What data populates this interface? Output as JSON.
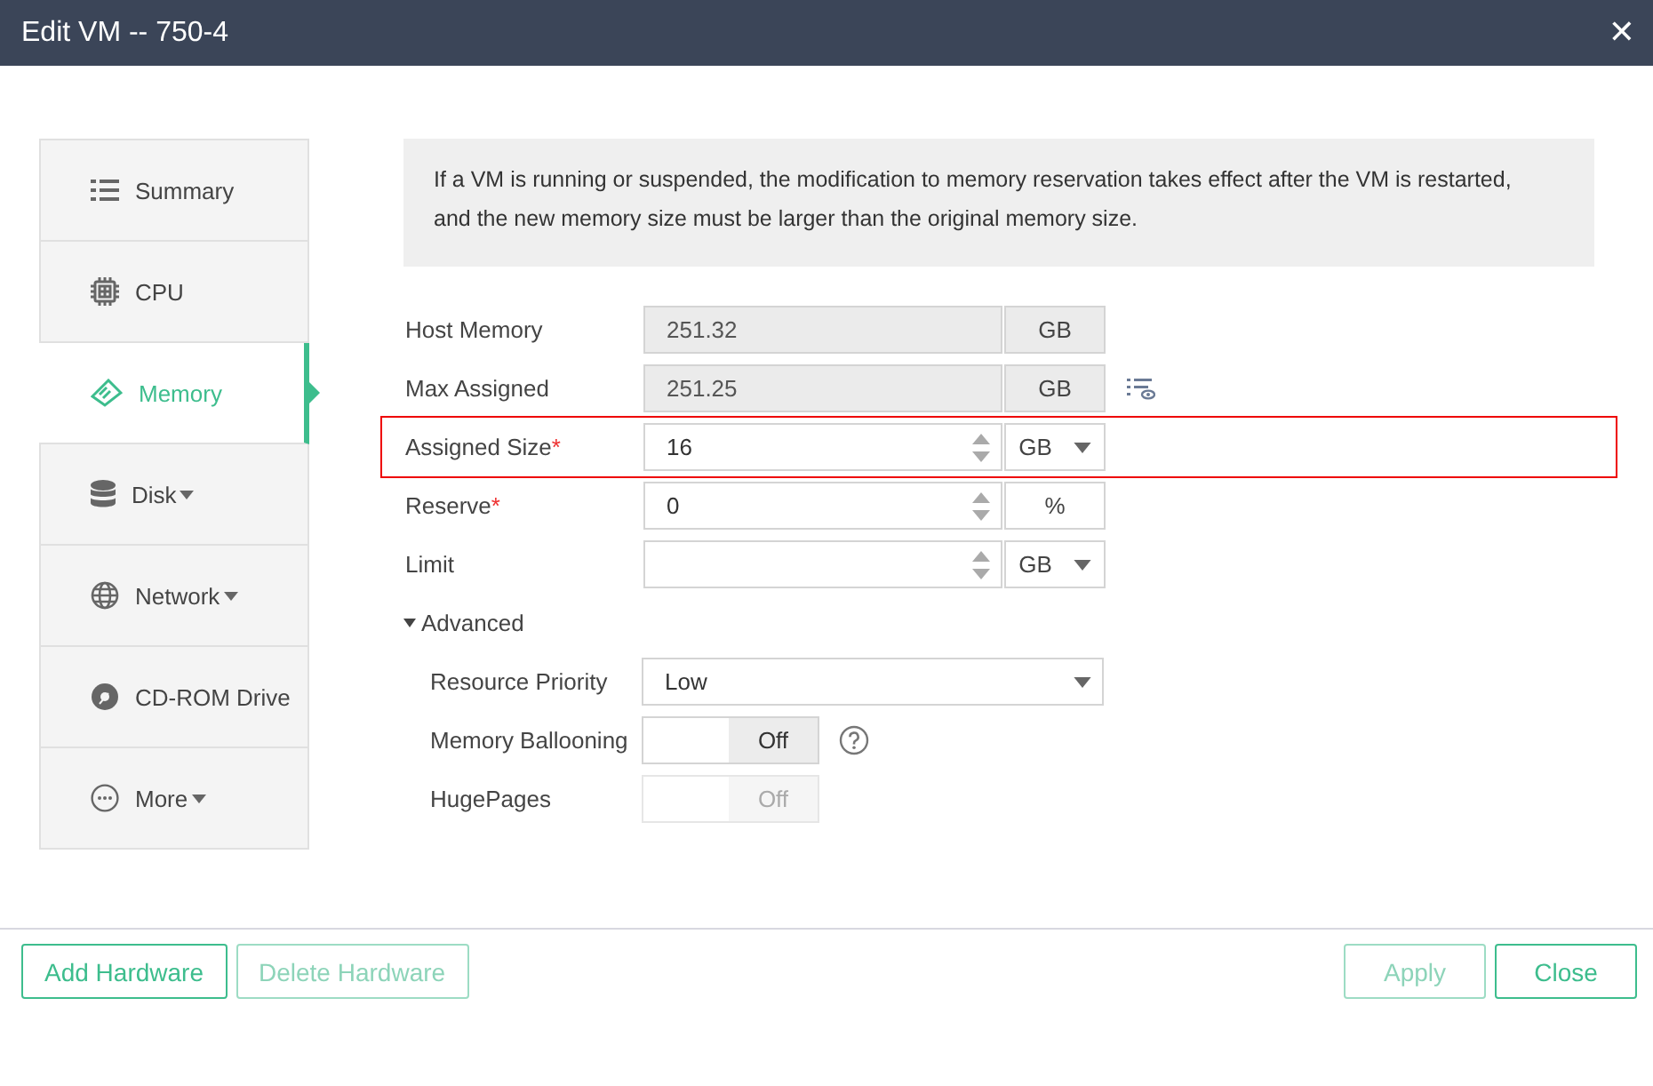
{
  "window": {
    "title": "Edit VM -- 750-4",
    "close": "✕"
  },
  "sidebar": {
    "items": [
      {
        "label": "Summary",
        "selected": false,
        "has_menu": false
      },
      {
        "label": "CPU",
        "selected": false,
        "has_menu": false
      },
      {
        "label": "Memory",
        "selected": true,
        "has_menu": false
      },
      {
        "label": "Disk",
        "selected": false,
        "has_menu": true
      },
      {
        "label": "Network",
        "selected": false,
        "has_menu": true
      },
      {
        "label": "CD-ROM Drive",
        "selected": false,
        "has_menu": false
      },
      {
        "label": "More",
        "selected": false,
        "has_menu": true
      }
    ]
  },
  "notice": "If a VM is running or suspended, the modification to memory reservation takes effect after the VM is restarted, and the new memory size must be larger than the original memory size.",
  "fields": [
    {
      "label": "Host Memory",
      "kind": "readonly",
      "value": "251.32",
      "unit": "GB",
      "unit_dropdown": false,
      "highlighted": false,
      "detail_icon": false
    },
    {
      "label": "Max Assigned",
      "kind": "readonly",
      "value": "251.25",
      "unit": "GB",
      "unit_dropdown": false,
      "highlighted": false,
      "detail_icon": true
    },
    {
      "label": "Assigned Size",
      "kind": "spinner",
      "required_mark": "*",
      "value": "16",
      "unit": "GB",
      "unit_dropdown": true,
      "highlighted": true,
      "detail_icon": false
    },
    {
      "label": "Reserve",
      "kind": "spinner",
      "required_mark": "*",
      "value": "0",
      "unit": "%",
      "unit_dropdown": false,
      "highlighted": false,
      "detail_icon": false
    },
    {
      "label": "Limit",
      "kind": "spinner",
      "unit": "GB",
      "unit_dropdown": true,
      "highlighted": false,
      "detail_icon": false
    }
  ],
  "advanced": {
    "label": "Advanced",
    "expanded": true,
    "items": [
      {
        "kind": "select",
        "label": "Resource Priority",
        "value": "Low"
      },
      {
        "kind": "toggle",
        "label": "Memory Ballooning",
        "value": "Off",
        "on": false,
        "disabled": false,
        "help": true
      },
      {
        "kind": "toggle",
        "label": "HugePages",
        "value": "Off",
        "on": false,
        "disabled": true
      }
    ]
  },
  "footer": {
    "left": [
      {
        "label": "Add Hardware",
        "disabled": false
      },
      {
        "label": "Delete Hardware",
        "disabled": true
      }
    ],
    "right": [
      {
        "label": "Apply",
        "disabled": true
      },
      {
        "label": "Close",
        "disabled": false
      }
    ]
  }
}
